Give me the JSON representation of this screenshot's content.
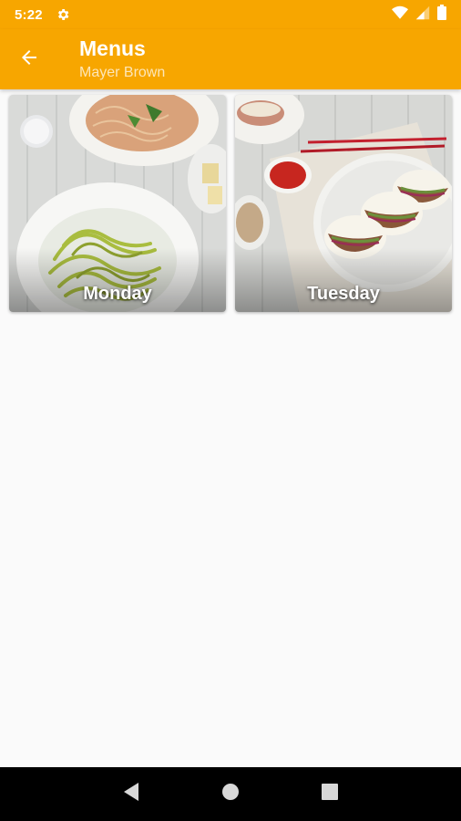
{
  "status_bar": {
    "time": "5:22",
    "icons": [
      "settings-gear-icon",
      "wifi-icon",
      "cell-signal-icon",
      "battery-icon"
    ]
  },
  "app_bar": {
    "title": "Menus",
    "subtitle": "Mayer Brown",
    "back_icon": "arrow-back-icon",
    "color": "#f7a600"
  },
  "menus": [
    {
      "label": "Monday",
      "image": "pasta-dishes-photo"
    },
    {
      "label": "Tuesday",
      "image": "bao-buns-photo"
    }
  ],
  "nav_bar": {
    "buttons": [
      "back-triangle-icon",
      "home-circle-icon",
      "recents-square-icon"
    ]
  }
}
